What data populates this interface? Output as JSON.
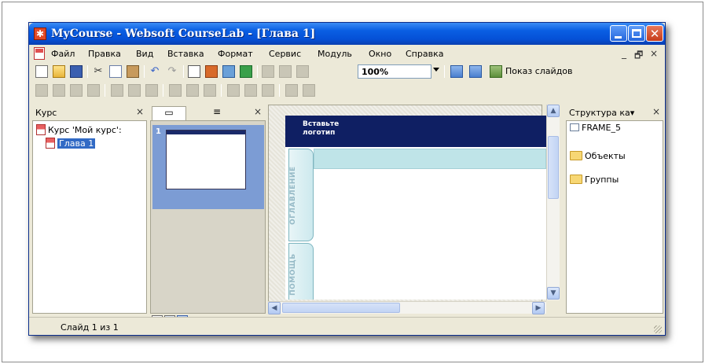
{
  "window": {
    "title": "MyCourse - Websoft CourseLab - [Глава 1]",
    "app_icon": "courselab-app-icon",
    "title_color": "#0a5fe3"
  },
  "menu": {
    "items": [
      "Файл",
      "Правка",
      "Вид",
      "Вставка",
      "Формат",
      "Сервис",
      "Модуль",
      "Окно",
      "Справка"
    ],
    "mdi_minimize": "_",
    "mdi_restore": "🗗",
    "mdi_close": "×"
  },
  "toolbar": {
    "zoom_value": "100%",
    "show_slides_label": "Показ слайдов",
    "icons": [
      "new-icon",
      "open-icon",
      "save-icon",
      "cut-icon",
      "copy-icon",
      "paste-icon",
      "undo-icon",
      "redo-icon",
      "textbox-icon",
      "image-icon",
      "shape-icon",
      "chart-icon",
      "format-painter-icon",
      "properties-icon",
      "link-icon",
      "add-slide-icon",
      "duplicate-slide-icon",
      "slideshow-icon"
    ]
  },
  "course_pane": {
    "title": "Курс",
    "close": "×",
    "root_label": "Курс 'Мой курс':",
    "chapter_label": "Глава 1"
  },
  "slides_pane": {
    "close": "×",
    "tab_slides_icon": "▭",
    "tab_outline_icon": "≡",
    "slide_number": "1"
  },
  "slide": {
    "logo_line1": "Вставьте",
    "logo_line2": "логотип",
    "tab_contents": "ОГЛАВЛЕНИЕ",
    "tab_help": "ПОМОЩЬ",
    "header_color": "#0f1f63",
    "band_color": "#bfe4e8"
  },
  "structure_pane": {
    "title": "Структура ка▾",
    "close": "×",
    "frame_label": "FRAME_5",
    "objects_label": "Объекты",
    "groups_label": "Группы"
  },
  "status": {
    "text": "Слайд 1 из 1"
  }
}
